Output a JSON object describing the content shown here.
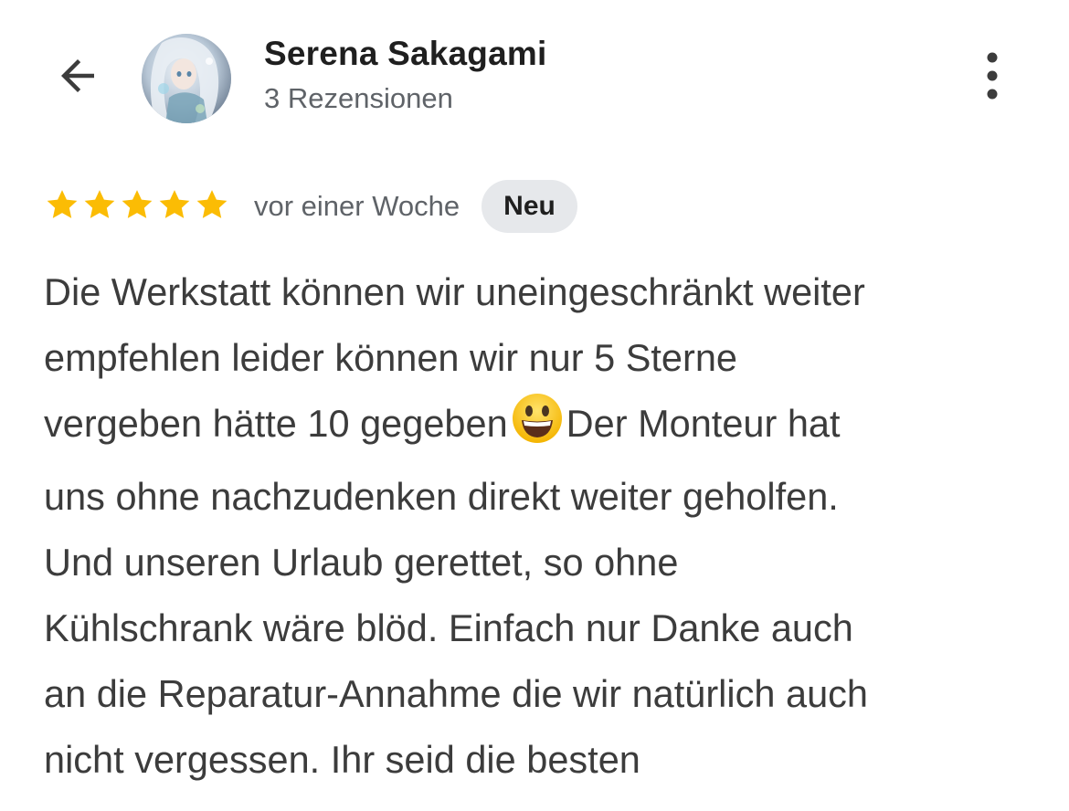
{
  "header": {
    "back_icon": "arrow-back-icon",
    "reviewer_name": "Serena Sakagami",
    "review_count": "3 Rezensionen",
    "more_icon": "more-vertical-icon"
  },
  "review": {
    "rating": 5,
    "rating_max": 5,
    "star_color": "#fbbc04",
    "date": "vor einer Woche",
    "badge": "Neu",
    "lines": {
      "l1": "Die Werkstatt können wir uneingeschränkt weiter",
      "l2": "empfehlen leider können wir nur 5 Sterne",
      "l3a": "vergeben hätte 10 gegeben",
      "l3b": "Der Monteur hat",
      "l4": "uns ohne nachzudenken direkt weiter geholfen.",
      "l5": "Und unseren Urlaub gerettet, so ohne",
      "l6": "Kühlschrank wäre blöd. Einfach nur Danke auch",
      "l7": "an die Reparatur-Annahme die wir natürlich auch",
      "l8": "nicht vergessen. Ihr seid die besten"
    },
    "emoji_icon": "grinning-face-icon"
  }
}
